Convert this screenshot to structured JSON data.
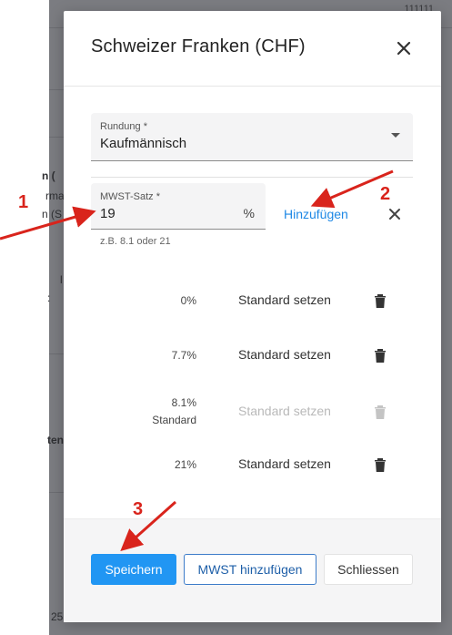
{
  "background": {
    "top_right_text": "111111",
    "left_fragments": [
      "n (",
      "rma",
      "n (S",
      "l",
      ":",
      "ten"
    ],
    "bottom_left_text": "25"
  },
  "dialog": {
    "title": "Schweizer Franken (CHF)",
    "rundung": {
      "label": "Rundung *",
      "value": "Kaufmännisch"
    },
    "mwst_input": {
      "label": "MWST-Satz *",
      "value": "19",
      "suffix": "%",
      "hint": "z.B. 8.1 oder 21"
    },
    "add_link": "Hinzufügen",
    "rates": [
      {
        "value": "0%",
        "is_standard": false,
        "set_label": "Standard setzen",
        "disabled": false
      },
      {
        "value": "7.7%",
        "is_standard": false,
        "set_label": "Standard setzen",
        "disabled": false
      },
      {
        "value": "8.1%",
        "is_standard": true,
        "standard_label": "Standard",
        "set_label": "Standard setzen",
        "disabled": true
      },
      {
        "value": "21%",
        "is_standard": false,
        "set_label": "Standard setzen",
        "disabled": false
      }
    ],
    "footer": {
      "save": "Speichern",
      "add_vat": "MWST hinzufügen",
      "close": "Schliessen"
    }
  },
  "annotations": {
    "one": "1",
    "two": "2",
    "three": "3"
  },
  "colors": {
    "primary": "#2196f3",
    "link": "#1e88e5",
    "annotation": "#d9241c"
  }
}
